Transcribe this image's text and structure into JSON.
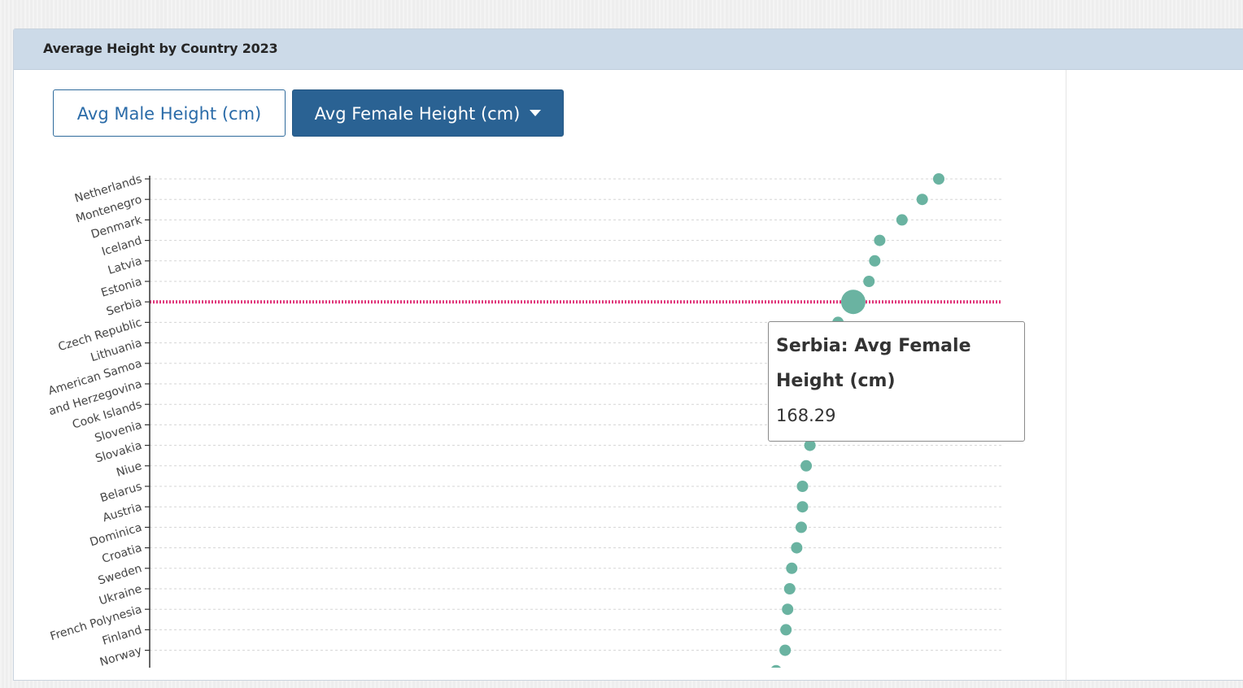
{
  "panel": {
    "title": "Average Height by Country 2023"
  },
  "buttons": {
    "male_label": "Avg Male Height (cm)",
    "female_label": "Avg Female Height (cm)"
  },
  "tooltip": {
    "title": "Serbia: Avg Female Height (cm)",
    "value": "168.29"
  },
  "colors": {
    "point": "#6ab3a1",
    "highlight_line": "#e0367a",
    "grid": "#d5d5d5",
    "header_bg": "#ccdae8",
    "button_active": "#2a6293"
  },
  "chart_data": {
    "type": "scatter",
    "orientation": "horizontal",
    "series": [
      {
        "categories": [
          "Netherlands",
          "Montenegro",
          "Denmark",
          "Iceland",
          "Latvia",
          "Estonia",
          "Serbia",
          "Czech Republic",
          "Lithuania",
          "American Samoa",
          "and Herzegovina",
          "Cook Islands",
          "Slovenia",
          "Slovakia",
          "Niue",
          "Belarus",
          "Austria",
          "Dominica",
          "Croatia",
          "Sweden",
          "Ukraine",
          "French Polynesia",
          "Finland",
          "Norway",
          null
        ],
        "values": [
          170.36,
          169.96,
          169.47,
          168.93,
          168.81,
          168.67,
          168.29,
          167.92,
          167.8,
          167.6,
          167.5,
          167.45,
          167.4,
          167.24,
          167.15,
          167.06,
          167.06,
          167.03,
          166.92,
          166.8,
          166.75,
          166.7,
          166.66,
          166.64,
          166.42
        ]
      }
    ],
    "highlighted_category": "Serbia",
    "grid": true
  }
}
